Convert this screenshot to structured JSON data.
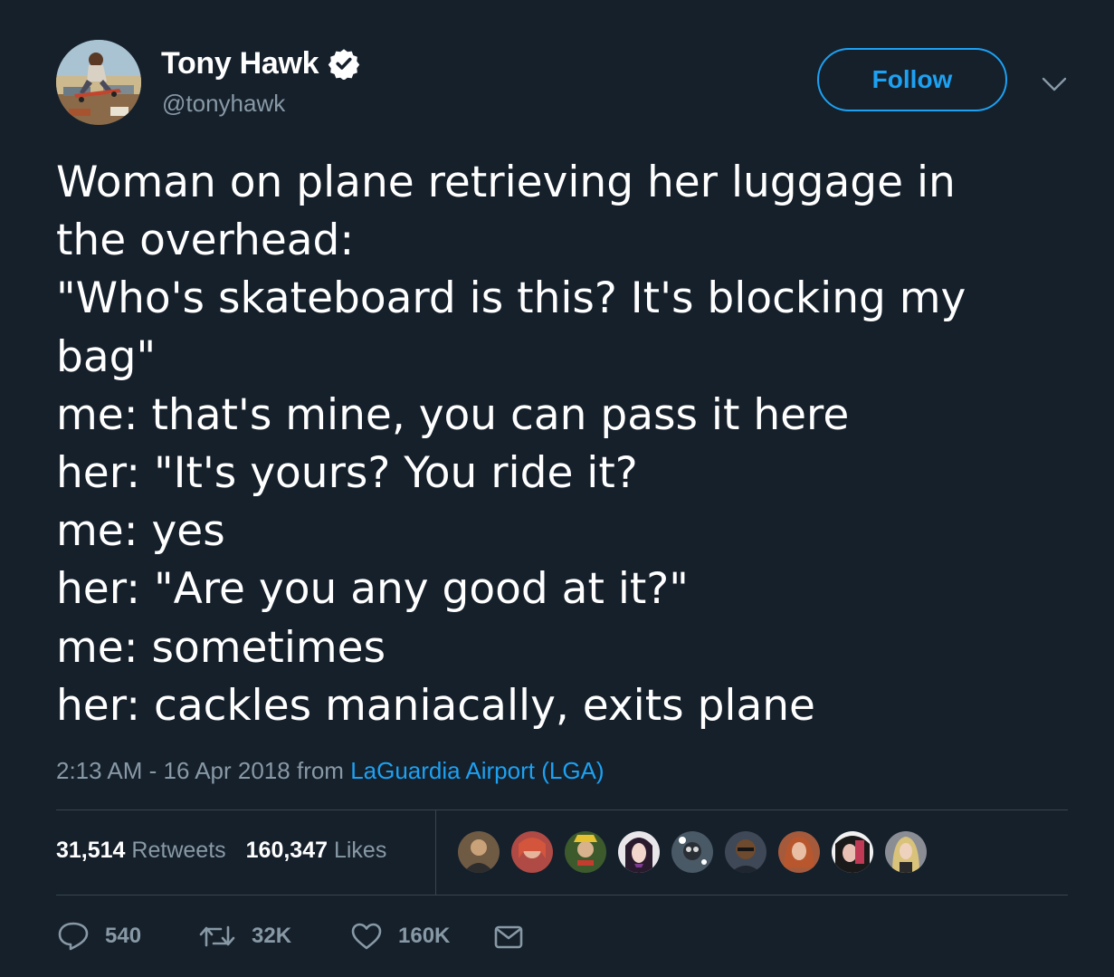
{
  "header": {
    "display_name": "Tony Hawk",
    "handle": "@tonyhawk",
    "follow_label": "Follow",
    "avatar_icon": "user-avatar-skateboarder",
    "verified_icon": "verified-badge-icon"
  },
  "tweet": {
    "lines": [
      "Woman on plane retrieving her luggage in",
      "the overhead:",
      "\"Who's skateboard is this? It's blocking my",
      "bag\"",
      "me: that's mine, you can pass it here",
      "her: \"It's yours? You ride it?",
      "me: yes",
      "her: \"Are you any good at it?\"",
      "me: sometimes",
      "her: cackles maniacally, exits plane"
    ]
  },
  "meta": {
    "timestamp": "2:13 AM - 16 Apr 2018",
    "from_label": "from",
    "location": "LaGuardia Airport (LGA)"
  },
  "stats": {
    "retweets_count": "31,514",
    "retweets_label": "Retweets",
    "likes_count": "160,347",
    "likes_label": "Likes",
    "liker_count": 9
  },
  "actions": {
    "reply_count": "540",
    "retweet_count": "32K",
    "like_count": "160K"
  },
  "colors": {
    "background": "#15202b",
    "text_primary": "#ffffff",
    "text_secondary": "#8899a6",
    "accent": "#1da1f2",
    "divider": "#38444d"
  }
}
